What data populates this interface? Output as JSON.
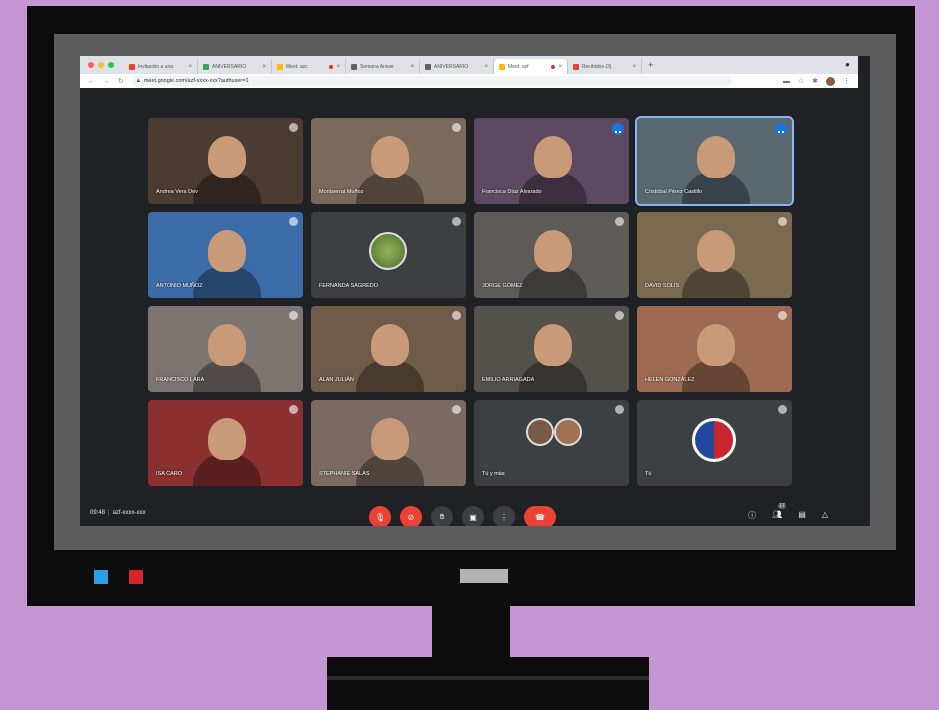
{
  "browser": {
    "tabs": [
      {
        "title": "Invitación a una",
        "favicon_color": "#ea4335"
      },
      {
        "title": "ANIVERSARIO",
        "favicon_color": "#34a853"
      },
      {
        "title": "Meet: azc",
        "favicon_color": "#fbbc04",
        "recording": true
      },
      {
        "title": "Semana Aniver",
        "favicon_color": "#5f6368"
      },
      {
        "title": "ANIVERSARIO",
        "favicon_color": "#5f6368"
      },
      {
        "title": "Meet: azf",
        "favicon_color": "#fbbc04",
        "recording": true,
        "active": true
      },
      {
        "title": "Recibidos (3)",
        "favicon_color": "#ea4335"
      }
    ],
    "url": "meet.google.com/azf-xxxx-xxx?authuser=1",
    "new_tab_label": "+"
  },
  "participants": [
    {
      "name": "Andrea Vera Dev",
      "bg": "#4a3b33"
    },
    {
      "name": "Montserrat Muñoz",
      "bg": "#7a6a5a"
    },
    {
      "name": "Francisca Díaz Alvarado",
      "bg": "#5c4a60",
      "speaking": true
    },
    {
      "name": "Cristóbal Pérez Castillo",
      "bg": "#5a6870",
      "speaking": true,
      "highlight": true
    },
    {
      "name": "ANTONIO MUÑOZ",
      "bg": "#3c6ca8"
    },
    {
      "name": "FERNANDA SAGREDO",
      "bg": "#3c4043",
      "avatar": true
    },
    {
      "name": "JORGE GÓMEZ",
      "bg": "#5e5a58"
    },
    {
      "name": "DAVID SOLÍS",
      "bg": "#7a6a50"
    },
    {
      "name": "FRANCISCO LARA",
      "bg": "#7d7572"
    },
    {
      "name": "ALAN JULIÁN",
      "bg": "#6e5b48"
    },
    {
      "name": "EMILIO ARRIAGADA",
      "bg": "#54504c"
    },
    {
      "name": "HELEN GONZÁLEZ",
      "bg": "#9e6a52"
    },
    {
      "name": "ISA CARO",
      "bg": "#8a3030"
    },
    {
      "name": "STEPHANIE SALAS",
      "bg": "#7a6a62"
    },
    {
      "name": "Tú y más",
      "bg": "#3c4043",
      "group": true
    },
    {
      "name": "Tú",
      "bg": "#3c4043",
      "logo": true
    }
  ],
  "meeting": {
    "time": "09:48",
    "code": "azf-xxxx-xxx"
  },
  "controls": {
    "mic": "mic-off",
    "camera": "camera-off",
    "hand": "raise-hand",
    "present": "present",
    "more": "more-options",
    "hangup": "leave-call"
  },
  "participant_count": "17"
}
